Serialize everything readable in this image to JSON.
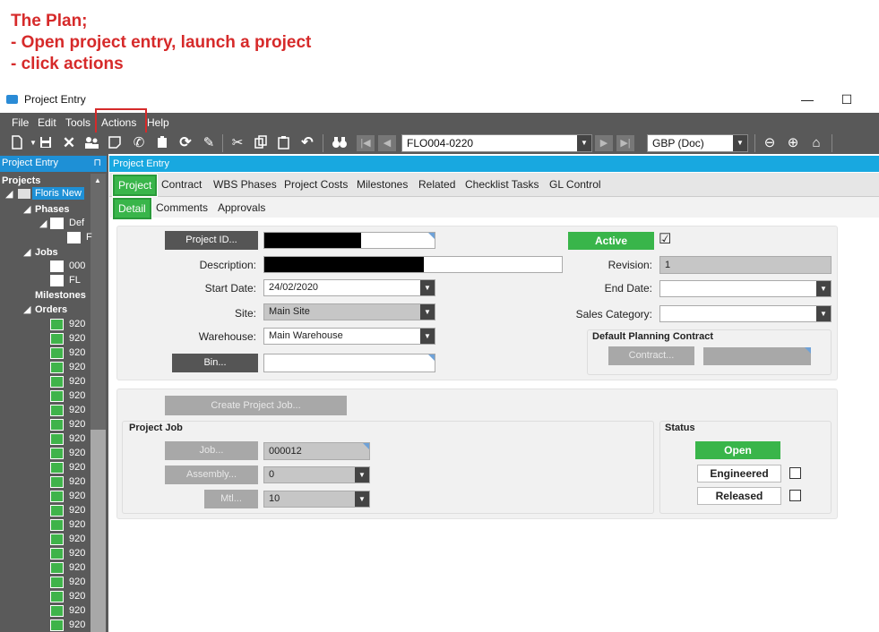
{
  "annotation": {
    "line1": "The Plan;",
    "line2": "- Open project entry, launch a  project",
    "line3": "- click actions"
  },
  "window": {
    "title": "Project Entry",
    "minimize": "—",
    "maximize": "☐"
  },
  "menu": [
    "File",
    "Edit",
    "Tools",
    "Actions",
    "Help"
  ],
  "toolbar": {
    "record_value": "FLO004-0220",
    "currency_value": "GBP (Doc)"
  },
  "left_panel": {
    "header": "Project Entry",
    "pin": "⊓",
    "projects_label": "Projects",
    "project_name": "Floris New",
    "phases_label": "Phases",
    "phase_item": "Def",
    "phase_child": "F",
    "jobs_label": "Jobs",
    "job_items": [
      "000",
      "FL"
    ],
    "milestones_label": "Milestones",
    "orders_label": "Orders",
    "order_items": [
      "920",
      "920",
      "920",
      "920",
      "920",
      "920",
      "920",
      "920",
      "920",
      "920",
      "920",
      "920",
      "920",
      "920",
      "920",
      "920",
      "920",
      "920",
      "920",
      "920",
      "920",
      "920"
    ]
  },
  "main": {
    "header": "Project Entry",
    "tabs": [
      "Project",
      "Contract",
      "WBS Phases",
      "Project Costs",
      "Milestones",
      "Related",
      "Checklist Tasks",
      "GL Control"
    ],
    "subtabs": [
      "Detail",
      "Comments",
      "Approvals"
    ]
  },
  "form": {
    "project_id_button": "Project ID...",
    "description_label": "Description:",
    "start_date_label": "Start Date:",
    "start_date_value": "24/02/2020",
    "site_label": "Site:",
    "site_value": "Main Site",
    "warehouse_label": "Warehouse:",
    "warehouse_value": "Main Warehouse",
    "bin_button": "Bin...",
    "active_label": "Active",
    "active_checked": "☑",
    "revision_label": "Revision:",
    "revision_value": "1",
    "end_date_label": "End Date:",
    "sales_category_label": "Sales Category:",
    "default_planning_contract_label": "Default Planning Contract",
    "contract_button": "Contract..."
  },
  "job": {
    "create_button": "Create Project Job...",
    "group_label": "Project Job",
    "job_button": "Job...",
    "job_value": "000012",
    "assembly_button": "Assembly...",
    "assembly_value": "0",
    "mtl_button": "Mtl...",
    "mtl_value": "10",
    "status_label": "Status",
    "open_label": "Open",
    "engineered_label": "Engineered",
    "released_label": "Released"
  },
  "colors": {
    "accent_blue": "#1e90d6",
    "green": "#39b54a",
    "annotation_red": "#d62a2a"
  }
}
